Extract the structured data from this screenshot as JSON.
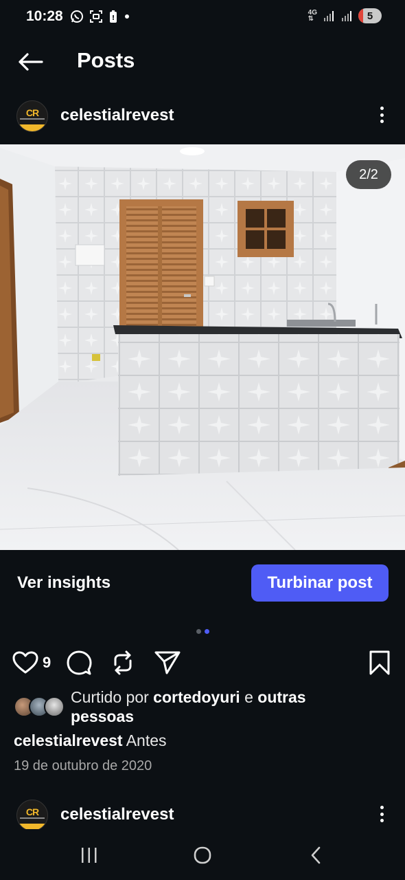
{
  "status_bar": {
    "time": "10:28",
    "network": "4G",
    "battery": "5",
    "left_icons": [
      "whatsapp-icon",
      "screenshot-icon",
      "battery-saver-icon",
      "dot-icon"
    ],
    "right_icons": [
      "signal-icon",
      "signal-icon"
    ]
  },
  "header": {
    "title": "Posts"
  },
  "post": {
    "username": "celestialrevest",
    "photo_counter": "2/2",
    "carousel_pages": 2,
    "carousel_active_index": 1,
    "insights_label": "Ver insights",
    "boost_label": "Turbinar post",
    "like_count": "9",
    "liked_prefix": "Curtido por ",
    "liked_user": "cortedoyuri",
    "liked_connector": " e ",
    "liked_others": "outras pessoas",
    "caption_user": "celestialrevest",
    "caption_text": " Antes",
    "date": "19 de outubro de 2020"
  },
  "next_post": {
    "username": "celestialrevest"
  },
  "colors": {
    "background": "#0c1014",
    "accent": "#4f5cf5",
    "brand_gold": "#f2b82b",
    "muted_text": "#a8a8a8"
  }
}
